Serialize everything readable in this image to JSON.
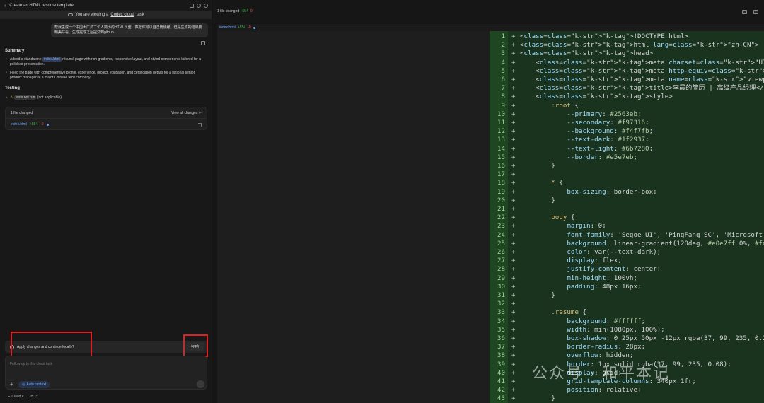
{
  "window": {
    "title": "Create an HTML resume template",
    "cloud_banner_prefix": "You are viewing a",
    "cloud_banner_link": "Codex cloud",
    "cloud_banner_suffix": "task"
  },
  "user_message": "帮我生成一个中国大厂员工个人简历的HTML页面，数据你可以自己随便编，但是生成的结果要精美好看。生成完成之后提交到github",
  "summary": {
    "heading": "Summary",
    "bullet1_pre": "Added a standalone",
    "bullet1_code": "index.html",
    "bullet1_post": "résumé page with rich gradients, responsive layout, and styled components tailored for a polished presentation.",
    "bullet2": "Filled the page with comprehensive profile, experience, project, education, and certification details for a fictional senior product manager at a major Chinese tech company."
  },
  "testing": {
    "heading": "Testing",
    "warn_icon": "⚠",
    "chip": "tests not run",
    "note": "(not applicable)"
  },
  "files_card": {
    "label": "1 file changed",
    "view_all": "View all changes ↗",
    "file_name": "index.html",
    "added": "+554",
    "removed": "-0"
  },
  "apply": {
    "question": "Apply changes and continue locally?",
    "button": "Apply"
  },
  "compose": {
    "placeholder": "Follow up to this cloud task",
    "plus": "+",
    "auto_context": "Auto context"
  },
  "footer": {
    "mode": "Cloud",
    "count": "1x"
  },
  "right": {
    "files_changed": "1 file changed",
    "added": "+554",
    "removed": "-0",
    "tab_file": "index.html",
    "tab_added": "+554",
    "tab_removed": "-0"
  },
  "code_lines": [
    "<!DOCTYPE html>",
    "<html lang=\"zh-CN\">",
    "<head>",
    "    <meta charset=\"UTF-8\" />",
    "    <meta http-equiv=\"X-UA-Compatible\" content=\"IE=edge\" />",
    "    <meta name=\"viewport\" content=\"width=device-width, initial-sca",
    "    <title>李晨的简历 | 高级产品经理</title>",
    "    <style>",
    "        :root {",
    "            --primary: #2563eb;",
    "            --secondary: #f97316;",
    "            --background: #f4f7fb;",
    "            --text-dark: #1f2937;",
    "            --text-light: #6b7280;",
    "            --border: #e5e7eb;",
    "        }",
    "",
    "        * {",
    "            box-sizing: border-box;",
    "        }",
    "",
    "        body {",
    "            margin: 0;",
    "            font-family: 'Segoe UI', 'PingFang SC', 'Microsoft Yal",
    "            background: linear-gradient(120deg, #e0e7ff 0%, #fdf2",
    "            color: var(--text-dark);",
    "            display: flex;",
    "            justify-content: center;",
    "            min-height: 100vh;",
    "            padding: 48px 16px;",
    "        }",
    "",
    "        .resume {",
    "            background: #ffffff;",
    "            width: min(1080px, 100%);",
    "            box-shadow: 0 25px 50px -12px rgba(37, 99, 235, 0.25)",
    "            border-radius: 28px;",
    "            overflow: hidden;",
    "            border: 1px solid rgba(37, 99, 235, 0.08);",
    "            display: grid;",
    "            grid-template-columns: 340px 1fr;",
    "            position: relative;",
    "        }"
  ],
  "watermark": "公众号 · 和平本记"
}
